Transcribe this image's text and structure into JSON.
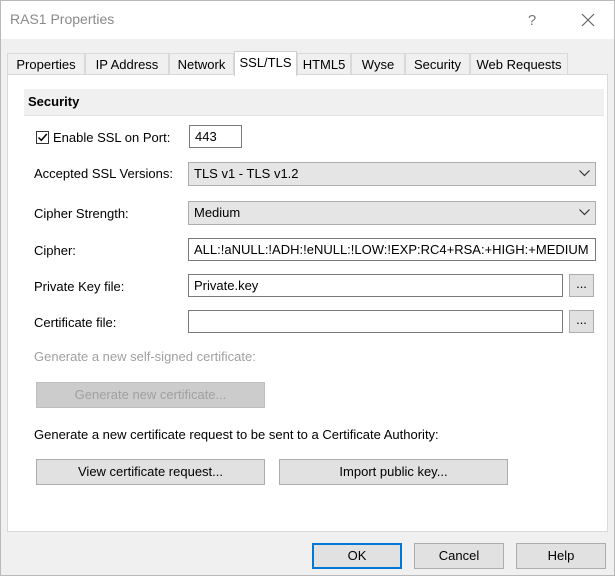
{
  "window": {
    "title": "RAS1 Properties",
    "help_glyph": "?"
  },
  "tabs": [
    {
      "label": "Properties"
    },
    {
      "label": "IP Address"
    },
    {
      "label": "Network"
    },
    {
      "label": "SSL/TLS",
      "active": true
    },
    {
      "label": "HTML5"
    },
    {
      "label": "Wyse"
    },
    {
      "label": "Security"
    },
    {
      "label": "Web Requests"
    }
  ],
  "security_group": {
    "title": "Security",
    "enable_ssl": {
      "label": "Enable SSL on Port:",
      "checked": true,
      "port": "443"
    },
    "ssl_versions": {
      "label": "Accepted SSL Versions:",
      "value": "TLS v1 - TLS v1.2"
    },
    "cipher_strength": {
      "label": "Cipher Strength:",
      "value": "Medium"
    },
    "cipher": {
      "label": "Cipher:",
      "value": "ALL:!aNULL:!ADH:!eNULL:!LOW:!EXP:RC4+RSA:+HIGH:+MEDIUM"
    },
    "private_key": {
      "label": "Private Key file:",
      "value": "Private.key",
      "browse": "..."
    },
    "certificate": {
      "label": "Certificate file:",
      "value": "",
      "browse": "..."
    },
    "self_signed_text": "Generate a new self-signed certificate:",
    "generate_button": "Generate new certificate...",
    "request_text": "Generate a new certificate request to be sent to a Certificate Authority:",
    "view_request_button": "View certificate request...",
    "import_key_button": "Import public key..."
  },
  "footer": {
    "ok": "OK",
    "cancel": "Cancel",
    "help": "Help"
  },
  "colors": {
    "accent": "#0078d7",
    "disabled_text": "#a0a0a0"
  }
}
